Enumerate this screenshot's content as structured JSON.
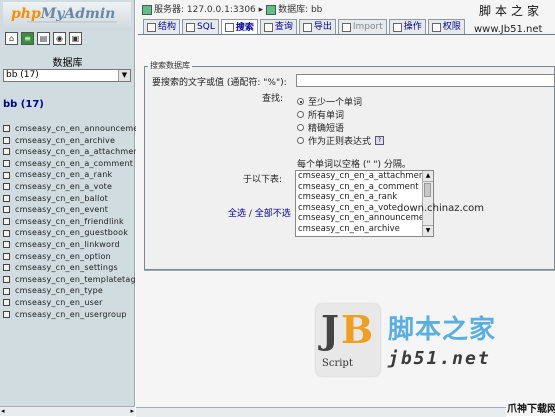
{
  "app": {
    "logo_main": "php",
    "logo_accent": "MyAdmin",
    "quick_icons": [
      "home-icon",
      "sql-query-icon",
      "db-icon",
      "docs-icon",
      "help-icon"
    ]
  },
  "sidebar": {
    "db_label": "数据库",
    "db_select_value": "bb (17)",
    "db_heading": "bb (17)",
    "tables": [
      "cmseasy_cn_en_announceme",
      "cmseasy_cn_en_archive",
      "cmseasy_cn_en_a_attachmen",
      "cmseasy_cn_en_a_comment",
      "cmseasy_cn_en_a_rank",
      "cmseasy_cn_en_a_vote",
      "cmseasy_cn_en_ballot",
      "cmseasy_cn_en_event",
      "cmseasy_cn_en_friendlink",
      "cmseasy_cn_en_guestbook",
      "cmseasy_cn_en_linkword",
      "cmseasy_cn_en_option",
      "cmseasy_cn_en_settings",
      "cmseasy_cn_en_templatetag",
      "cmseasy_cn_en_type",
      "cmseasy_cn_en_user",
      "cmseasy_cn_en_usergroup"
    ]
  },
  "header": {
    "server_label": "服务器: 127.0.0.1:3306",
    "separator": "▸",
    "db_label": "数据库: bb",
    "watermark_top": "脚本之家",
    "watermark_url": "www.Jb51.net"
  },
  "tabs": [
    {
      "label": "结构",
      "icon": "structure-icon"
    },
    {
      "label": "SQL",
      "icon": "sql-icon"
    },
    {
      "label": "搜索",
      "icon": "search-icon",
      "active": true
    },
    {
      "label": "查询",
      "icon": "query-icon"
    },
    {
      "label": "导出",
      "icon": "export-icon"
    },
    {
      "label": "Import",
      "icon": "import-icon",
      "disabled": true
    },
    {
      "label": "操作",
      "icon": "operations-icon"
    },
    {
      "label": "权限",
      "icon": "privileges-icon"
    }
  ],
  "search_form": {
    "legend": "搜索数据库",
    "words_label": "要搜索的文字或值 (通配符: \"%\"):",
    "words_value": "",
    "find_label": "查找:",
    "find_options": [
      {
        "label": "至少一个单词",
        "selected": true
      },
      {
        "label": "所有单词",
        "selected": false
      },
      {
        "label": "精确短语",
        "selected": false
      },
      {
        "label": "作为正则表达式",
        "selected": false
      }
    ],
    "help_icon": "help-icon",
    "hint": "每个单词以空格 (\" \") 分隔。",
    "tables_label": "于以下表:",
    "table_options": [
      "cmseasy_cn_en_a_attachment",
      "cmseasy_cn_en_a_comment",
      "cmseasy_cn_en_a_rank",
      "cmseasy_cn_en_a_vote",
      "cmseasy_cn_en_announcement",
      "cmseasy_cn_en_archive"
    ],
    "select_all": "全选",
    "select_sep": " / ",
    "select_none": "全部不选",
    "site_mark": "down.chinaz.com"
  },
  "brand_watermark": {
    "logo_j": "J",
    "logo_b": "B",
    "logo_script": "Script",
    "cn_name": "脚本之家",
    "domain": "jb51.net",
    "corner": "爪神下载网"
  },
  "colors": {
    "sidebar_bg": "#d0dce0",
    "link_blue": "#00009a",
    "logo_orange": "#ff8c00",
    "watermark_blue": "#5aaee0"
  }
}
